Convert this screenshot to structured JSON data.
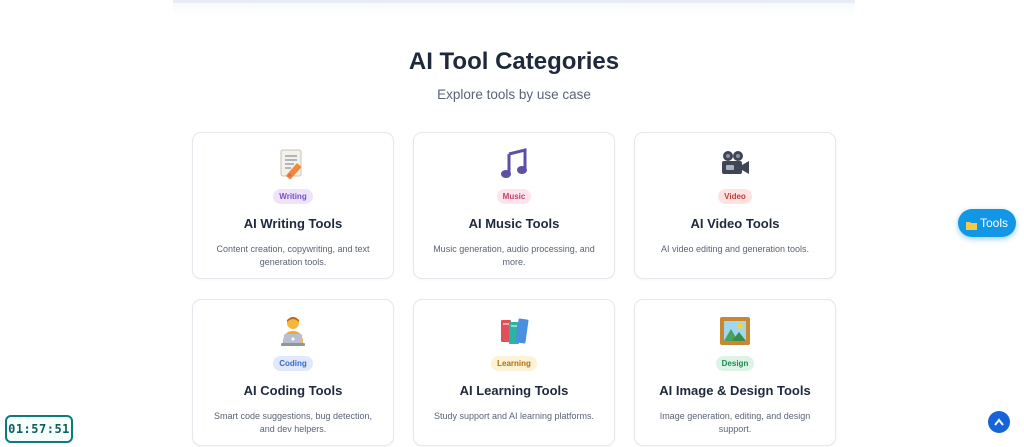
{
  "header": {
    "title": "AI Tool Categories",
    "subtitle": "Explore tools by use case"
  },
  "categories": [
    {
      "badge": "Writing",
      "title": "AI Writing Tools",
      "description": "Content creation, copywriting, and text generation tools.",
      "icon": "memo-pencil-icon",
      "badge_bg": "#ede4fb",
      "badge_color": "#7c4dca"
    },
    {
      "badge": "Music",
      "title": "AI Music Tools",
      "description": "Music generation, audio processing, and more.",
      "icon": "music-note-icon",
      "badge_bg": "#fde4ec",
      "badge_color": "#c2416b"
    },
    {
      "badge": "Video",
      "title": "AI Video Tools",
      "description": "AI video editing and generation tools.",
      "icon": "movie-camera-icon",
      "badge_bg": "#fde2e2",
      "badge_color": "#c53a3a"
    },
    {
      "badge": "Coding",
      "title": "AI Coding Tools",
      "description": "Smart code suggestions, bug detection, and dev helpers.",
      "icon": "technologist-icon",
      "badge_bg": "#dfe9fb",
      "badge_color": "#3b6ac7"
    },
    {
      "badge": "Learning",
      "title": "AI Learning Tools",
      "description": "Study support and AI learning platforms.",
      "icon": "books-icon",
      "badge_bg": "#fdf1d6",
      "badge_color": "#b0700e"
    },
    {
      "badge": "Design",
      "title": "AI Image & Design Tools",
      "description": "Image generation, editing, and design support.",
      "icon": "framed-picture-icon",
      "badge_bg": "#dcf3e6",
      "badge_color": "#1e8a52"
    }
  ],
  "floating": {
    "tools_label": "Tools",
    "clock_time": "01:57:51"
  },
  "colors": {
    "accent": "#1296e6",
    "scroll_top": "#1565d8",
    "clock_border": "#0e7a7a"
  }
}
